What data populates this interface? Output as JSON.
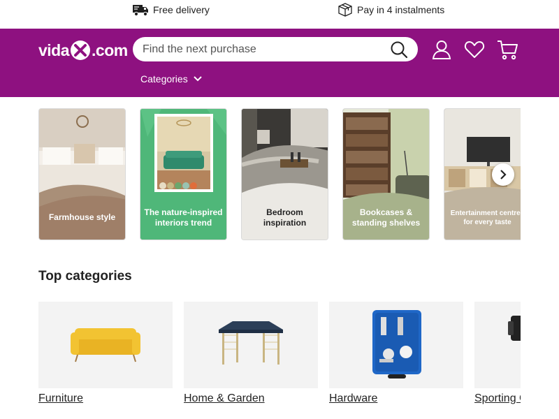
{
  "usps": {
    "delivery": "Free delivery",
    "instalments": "Pay in 4 instalments"
  },
  "header": {
    "logo_left": "vida",
    "logo_right": ".com",
    "search_placeholder": "Find the next purchase",
    "categories_label": "Categories",
    "brand_color": "#8e1180"
  },
  "carousel": {
    "cards": [
      {
        "label": "Farmhouse style"
      },
      {
        "label": "The nature-inspired interiors trend"
      },
      {
        "label": "Bedroom inspiration"
      },
      {
        "label": "Bookcases & standing shelves"
      },
      {
        "label": "Entertainment centres for every taste"
      }
    ]
  },
  "top_categories": {
    "title": "Top categories",
    "items": [
      {
        "label": "Furniture"
      },
      {
        "label": "Home & Garden"
      },
      {
        "label": "Hardware"
      },
      {
        "label": "Sporting Goods"
      }
    ]
  }
}
